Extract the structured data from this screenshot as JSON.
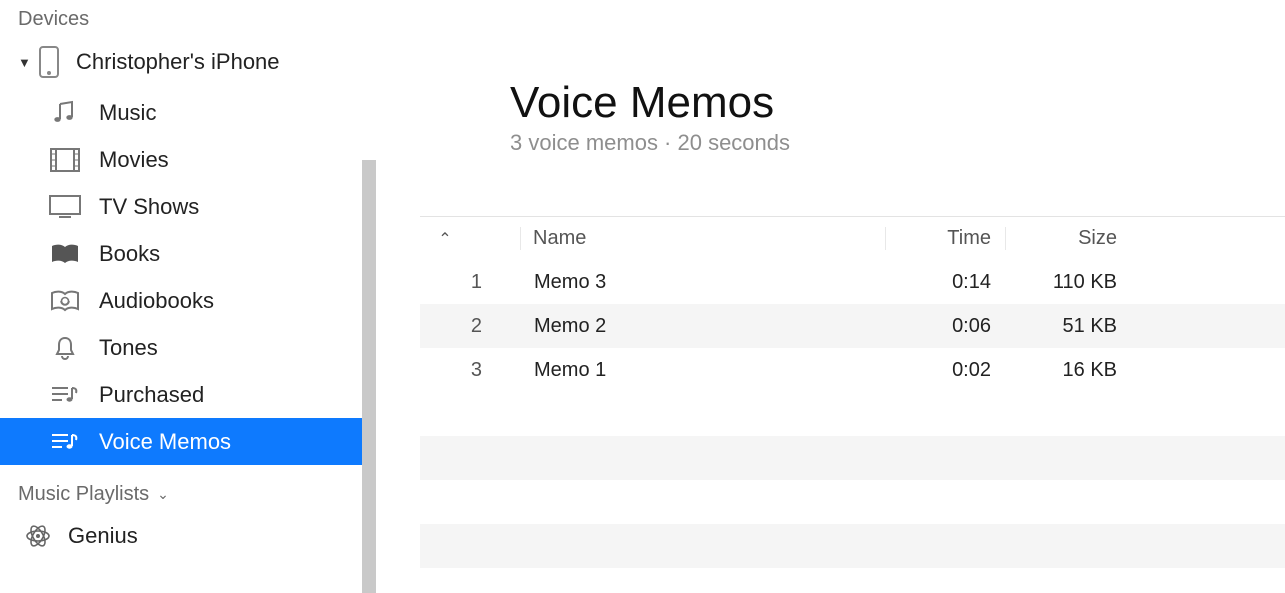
{
  "sidebar": {
    "devices_header": "Devices",
    "device_name": "Christopher's iPhone",
    "items": [
      {
        "label": "Music"
      },
      {
        "label": "Movies"
      },
      {
        "label": "TV Shows"
      },
      {
        "label": "Books"
      },
      {
        "label": "Audiobooks"
      },
      {
        "label": "Tones"
      },
      {
        "label": "Purchased"
      },
      {
        "label": "Voice Memos"
      }
    ],
    "playlists_header": "Music Playlists",
    "genius_label": "Genius"
  },
  "main": {
    "title": "Voice Memos",
    "subtitle": "3 voice memos · 20 seconds",
    "columns": {
      "name": "Name",
      "time": "Time",
      "size": "Size"
    },
    "rows": [
      {
        "index": "1",
        "name": "Memo 3",
        "time": "0:14",
        "size": "110 KB"
      },
      {
        "index": "2",
        "name": "Memo 2",
        "time": "0:06",
        "size": "51 KB"
      },
      {
        "index": "3",
        "name": "Memo 1",
        "time": "0:02",
        "size": "16 KB"
      }
    ]
  }
}
